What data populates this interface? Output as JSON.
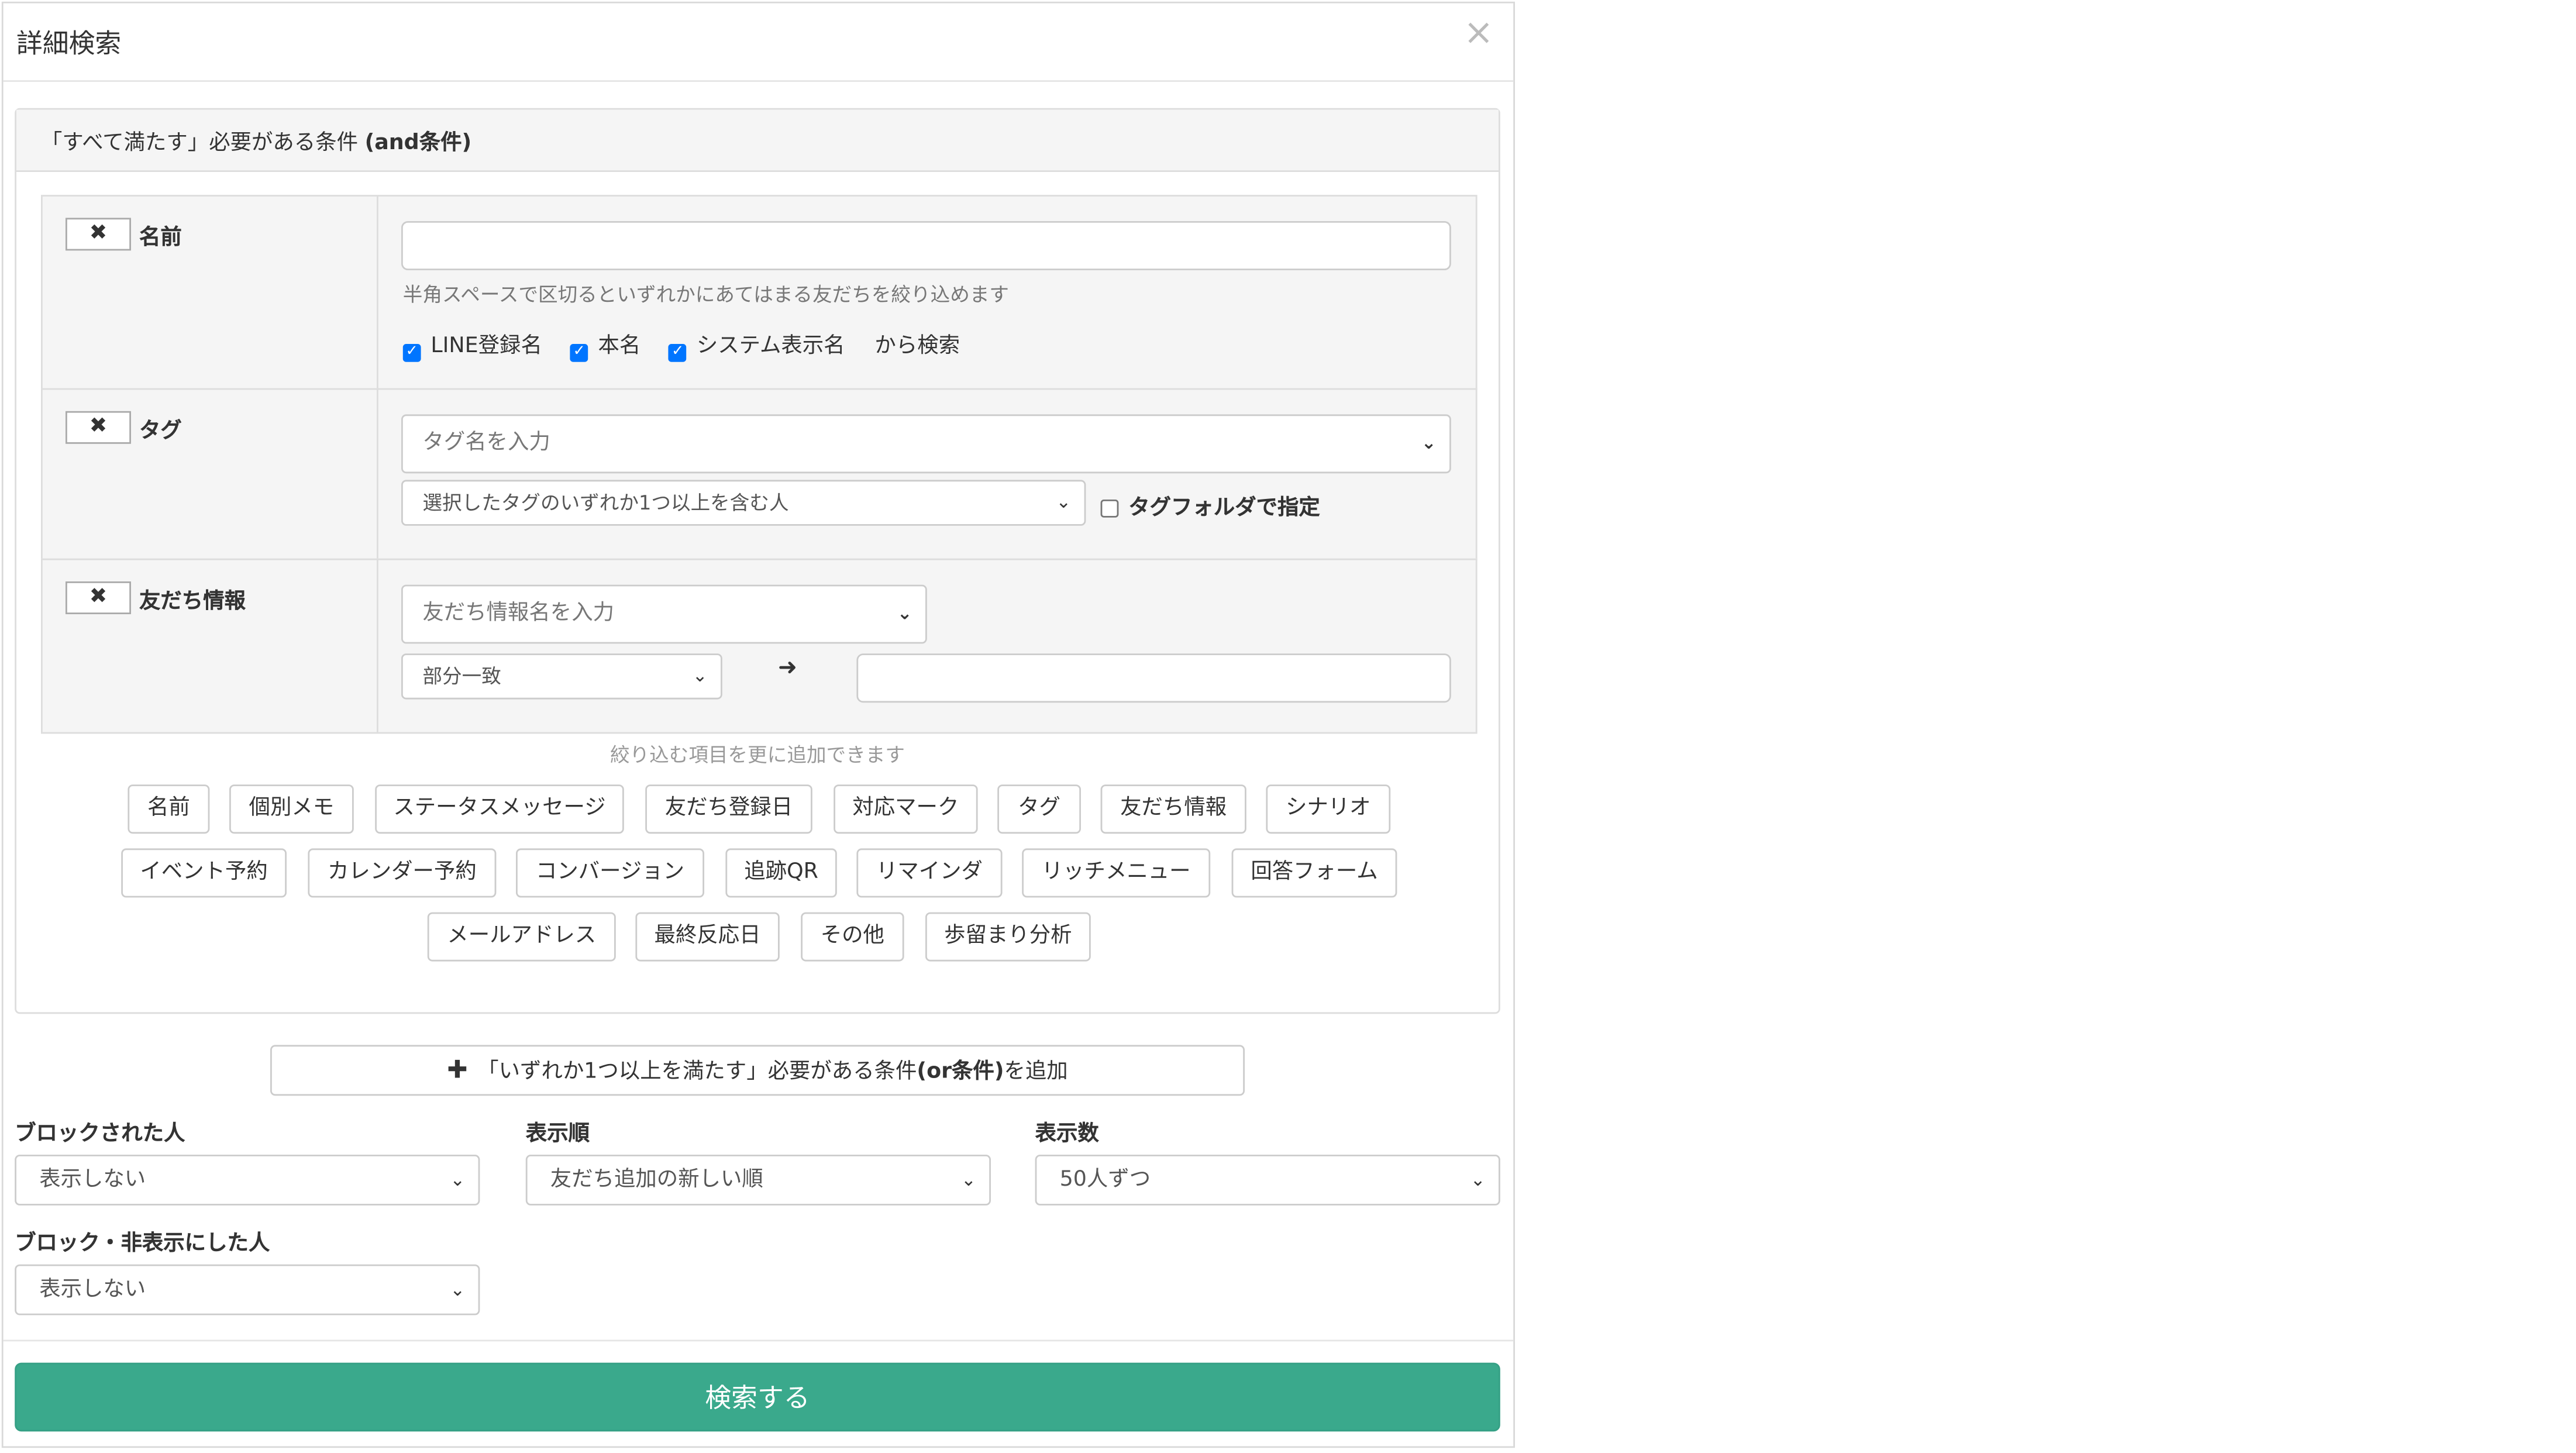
{
  "modal": {
    "title": "詳細検索",
    "close": "×"
  },
  "and_panel": {
    "heading_prefix": "「すべて満たす」必要がある条件 ",
    "heading_bold": "(and条件)"
  },
  "conditions": {
    "name": {
      "remove": "✖",
      "label": "名前",
      "value": "",
      "help": "半角スペースで区切るといずれかにあてはまる友だちを絞り込めます",
      "checks": [
        {
          "label": "LINE登録名",
          "checked": true
        },
        {
          "label": "本名",
          "checked": true
        },
        {
          "label": "システム表示名",
          "checked": true
        }
      ],
      "suffix": "から検索"
    },
    "tag": {
      "remove": "✖",
      "label": "タグ",
      "placeholder": "タグ名を入力",
      "match_mode": "選択したタグのいずれか1つ以上を含む人",
      "folder_check": {
        "label": "タグフォルダで指定",
        "checked": false
      }
    },
    "friend_info": {
      "remove": "✖",
      "label": "友だち情報",
      "placeholder": "友だち情報名を入力",
      "match_mode": "部分一致",
      "arrow": "➜",
      "value": ""
    }
  },
  "add_hint": "絞り込む項目を更に追加できます",
  "chips_row1": [
    "名前",
    "個別メモ",
    "ステータスメッセージ",
    "友だち登録日",
    "対応マーク",
    "タグ",
    "友だち情報",
    "シナリオ"
  ],
  "chips_row2": [
    "イベント予約",
    "カレンダー予約",
    "コンバージョン",
    "追跡QR",
    "リマインダ",
    "リッチメニュー",
    "回答フォーム"
  ],
  "chips_row3": [
    "メールアドレス",
    "最終反応日",
    "その他",
    "歩留まり分析"
  ],
  "or_button": {
    "plus": "✚",
    "prefix": "「いずれか1つ以上を満たす」必要がある条件",
    "bold": "(or条件)",
    "suffix": "を追加"
  },
  "options": {
    "blocked": {
      "label": "ブロックされた人",
      "value": "表示しない"
    },
    "order": {
      "label": "表示順",
      "value": "友だち追加の新しい順"
    },
    "count": {
      "label": "表示数",
      "value": "50人ずつ"
    },
    "hidden": {
      "label": "ブロック・非表示にした人",
      "value": "表示しない"
    }
  },
  "search_button": "検索する",
  "icons": {
    "dropdown": "chevron-down-icon",
    "remove": "times-icon",
    "arrow": "arrow-right-icon",
    "plus": "plus-icon"
  },
  "colors": {
    "primary": "#3aa98c",
    "checkbox": "#0075ff"
  }
}
